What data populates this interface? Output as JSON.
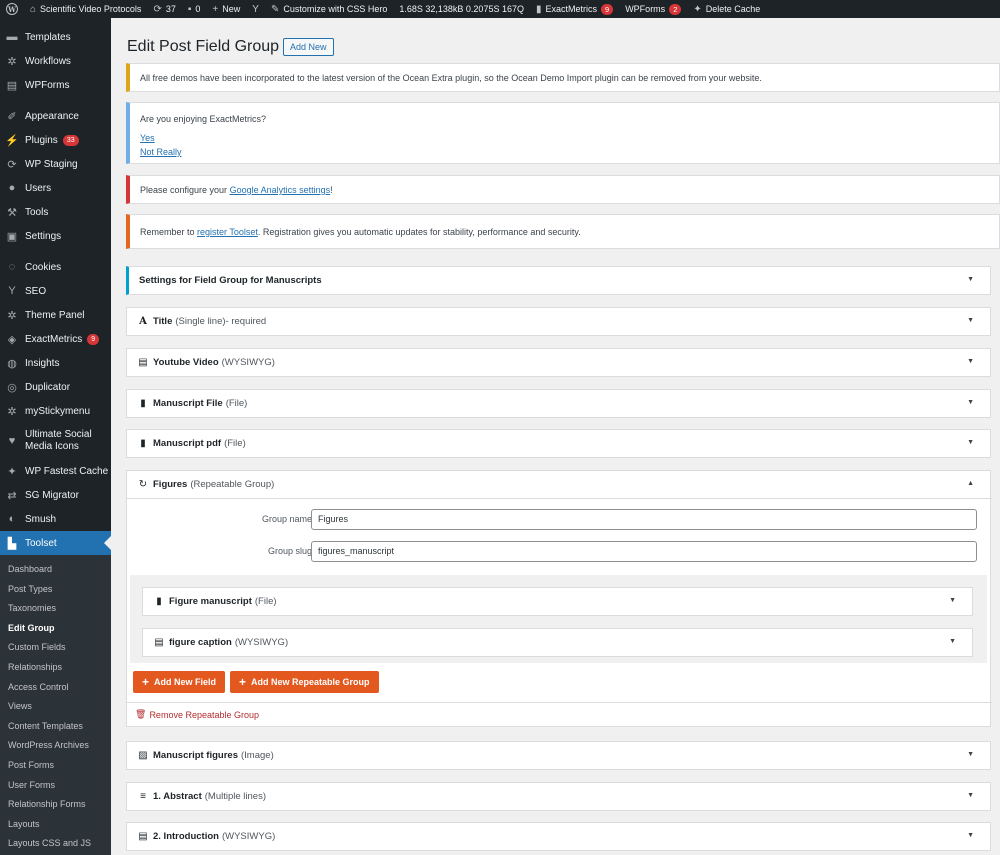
{
  "adminbar": {
    "site_name": "Scientific Video Protocols",
    "updates_count": "37",
    "comments_count": "0",
    "new_label": "New",
    "css_hero_label": "Customize with CSS Hero",
    "stats": "1.68S  32,138kB  0.2075S  167Q",
    "exactmetrics_label": "ExactMetrics",
    "exactmetrics_badge": "9",
    "wpforms_label": "WPForms",
    "wpforms_badge": "2",
    "delete_cache_label": "Delete Cache"
  },
  "sidebar": {
    "items": [
      {
        "label": "Templates",
        "icon": "folder-icon"
      },
      {
        "label": "Workflows",
        "icon": "gear-icon"
      },
      {
        "label": "WPForms",
        "icon": "form-icon"
      },
      {
        "label": "Appearance",
        "icon": "brush-icon"
      },
      {
        "label": "Plugins",
        "icon": "plug-icon",
        "badge": "33"
      },
      {
        "label": "WP Staging",
        "icon": "refresh-icon"
      },
      {
        "label": "Users",
        "icon": "user-icon"
      },
      {
        "label": "Tools",
        "icon": "wrench-icon"
      },
      {
        "label": "Settings",
        "icon": "settings-icon"
      },
      {
        "label": "Cookies",
        "icon": "cookie-icon"
      },
      {
        "label": "SEO",
        "icon": "yoast-icon"
      },
      {
        "label": "Theme Panel",
        "icon": "gear-icon"
      },
      {
        "label": "ExactMetrics",
        "icon": "chart-icon",
        "badge": "9"
      },
      {
        "label": "Insights",
        "icon": "insights-icon"
      },
      {
        "label": "Duplicator",
        "icon": "duplicator-icon"
      },
      {
        "label": "myStickymenu",
        "icon": "gear-icon"
      },
      {
        "label": "Ultimate Social Media Icons",
        "icon": "social-icon"
      },
      {
        "label": "WP Fastest Cache",
        "icon": "cheetah-icon"
      },
      {
        "label": "SG Migrator",
        "icon": "migrator-icon"
      },
      {
        "label": "Smush",
        "icon": "smush-icon"
      },
      {
        "label": "Toolset",
        "icon": "toolset-icon"
      }
    ],
    "submenu": [
      "Dashboard",
      "Post Types",
      "Taxonomies",
      "Edit Group",
      "Custom Fields",
      "Relationships",
      "Access Control",
      "Views",
      "Content Templates",
      "WordPress Archives",
      "Post Forms",
      "User Forms",
      "Relationship Forms",
      "Layouts",
      "Layouts CSS and JS"
    ]
  },
  "page": {
    "title": "Edit Post Field Group",
    "add_new": "Add New"
  },
  "notices": {
    "ocean": "All free demos have been incorporated to the latest version of the Ocean Extra plugin, so the Ocean Demo Import plugin can be removed from your website.",
    "enjoy_question": "Are you enjoying ExactMetrics?",
    "enjoy_yes": "Yes",
    "enjoy_no": "Not Really",
    "ga_prefix": "Please configure your ",
    "ga_link": "Google Analytics settings",
    "ga_suffix": "!",
    "toolset_prefix": "Remember to ",
    "toolset_link": "register Toolset",
    "toolset_suffix": ". Registration gives you automatic updates for stability, performance and security."
  },
  "fields": {
    "settings": {
      "title": "Settings for Field Group for Manuscripts"
    },
    "title_field": {
      "title": "Title",
      "type": "(Single line)",
      "extra": " - required"
    },
    "youtube": {
      "title": "Youtube Video",
      "type": "(WYSIWYG)"
    },
    "manuscript_file": {
      "title": "Manuscript File",
      "type": "(File)"
    },
    "manuscript_pdf": {
      "title": "Manuscript pdf",
      "type": "(File)"
    },
    "figures": {
      "title": "Figures",
      "type": "(Repeatable Group)",
      "group_name_label": "Group name",
      "group_name_value": "Figures",
      "group_slug_label": "Group slug",
      "group_slug_value": "figures_manuscript",
      "figure_manuscript": {
        "title": "Figure manuscript",
        "type": "(File)"
      },
      "figure_caption": {
        "title": "figure caption",
        "type": "(WYSIWYG)"
      },
      "add_field": "Add New Field",
      "add_repeatable": "Add New Repeatable Group",
      "remove": "Remove Repeatable Group"
    },
    "manuscript_figures": {
      "title": "Manuscript figures",
      "type": "(Image)"
    },
    "abstract": {
      "title": "1. Abstract",
      "type": "(Multiple lines)"
    },
    "introduction": {
      "title": "2. Introduction",
      "type": "(WYSIWYG)"
    }
  },
  "colors": {
    "accent": "#2271b1",
    "orange_button": "#e2581f",
    "sidebar_bg": "#1d2327"
  }
}
